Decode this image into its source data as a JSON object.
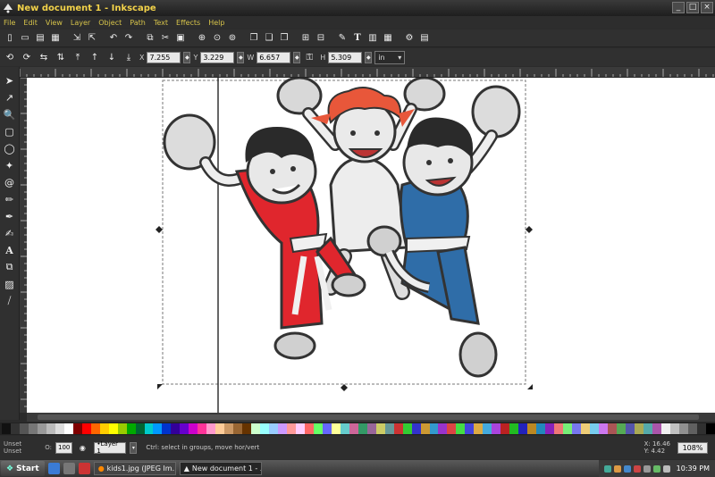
{
  "window": {
    "title": "New document 1 - Inkscape"
  },
  "menu": [
    "File",
    "Edit",
    "View",
    "Layer",
    "Object",
    "Path",
    "Text",
    "Effects",
    "Help"
  ],
  "controls": {
    "x_label": "X",
    "x_value": "7.255",
    "y_label": "Y",
    "y_value": "3.229",
    "w_label": "W",
    "w_value": "6.657",
    "h_label": "H",
    "h_value": "5.309",
    "units": "in"
  },
  "status": {
    "fill_label": "Unset",
    "stroke_label": "Unset",
    "opacity_label": "O:",
    "opacity_value": "100",
    "layer": "•Layer 1",
    "message": "Ctrl: select in groups, move hor/vert",
    "coord_x": "X: 16.46",
    "coord_y": "Y: 4.42",
    "zoom": "108%"
  },
  "taskbar": {
    "start": "Start",
    "items": [
      "kids1.jpg (JPEG Im...",
      "New document 1 - ..."
    ],
    "clock": "10:39 PM"
  },
  "palette": [
    "#111111",
    "#333333",
    "#555555",
    "#777777",
    "#999999",
    "#bbbbbb",
    "#dddddd",
    "#ffffff",
    "#800000",
    "#ff0000",
    "#ff6600",
    "#ffcc00",
    "#ffff00",
    "#99cc00",
    "#00aa00",
    "#006633",
    "#00cccc",
    "#0099ff",
    "#0033cc",
    "#330099",
    "#6600cc",
    "#cc00cc",
    "#ff3399",
    "#ff99cc",
    "#ffcc99",
    "#cc9966",
    "#996633",
    "#663300",
    "#ccffcc",
    "#99ffff",
    "#99ccff",
    "#cc99ff",
    "#ff9999",
    "#ffccff",
    "#ff6666",
    "#66ff66",
    "#6666ff",
    "#ffff99",
    "#66cccc",
    "#cc6699",
    "#339966",
    "#996699",
    "#cccc66",
    "#669999",
    "#cc3333",
    "#33cc33",
    "#3333cc",
    "#cc9933",
    "#3399cc",
    "#9933cc",
    "#dd4444",
    "#44dd44",
    "#4444dd",
    "#ddaa44",
    "#44aadd",
    "#aa44dd",
    "#bb2222",
    "#22bb22",
    "#2222bb",
    "#bb8822",
    "#2288bb",
    "#8822bb",
    "#ee7777",
    "#77ee77",
    "#7777ee",
    "#eecc77",
    "#77ccee",
    "#cc77ee",
    "#aa5555",
    "#55aa55",
    "#5555aa",
    "#aaaa55",
    "#55aaaa",
    "#aa55aa",
    "#f0f0f0",
    "#c0c0c0",
    "#909090",
    "#606060",
    "#303030",
    "#000000"
  ]
}
